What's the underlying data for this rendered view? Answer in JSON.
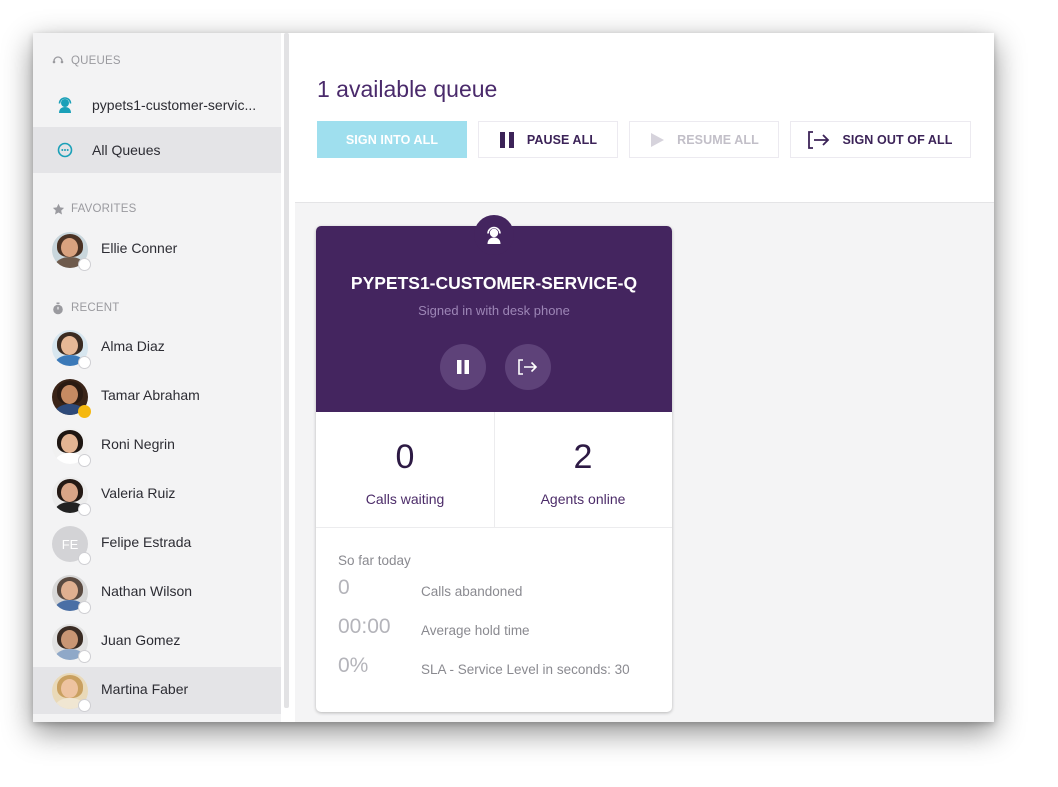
{
  "sidebar": {
    "queues_header": "QUEUES",
    "queue_items": [
      {
        "label": "pypets1-customer-servic...",
        "icon": "agent-headset-icon"
      },
      {
        "label": "All Queues",
        "icon": "chat-bubble-icon"
      }
    ],
    "favorites_header": "FAVORITES",
    "favorites": [
      {
        "name": "Ellie Conner"
      }
    ],
    "recent_header": "RECENT",
    "recent": [
      {
        "name": "Alma Diaz",
        "status": "offline"
      },
      {
        "name": "Tamar Abraham",
        "status": "away"
      },
      {
        "name": "Roni Negrin",
        "status": "offline"
      },
      {
        "name": "Valeria Ruiz",
        "status": "offline"
      },
      {
        "name": "Felipe Estrada",
        "initials": "FE",
        "status": "offline"
      },
      {
        "name": "Nathan Wilson",
        "status": "offline"
      },
      {
        "name": "Juan Gomez",
        "status": "offline"
      },
      {
        "name": "Martina Faber",
        "status": "offline"
      }
    ]
  },
  "main": {
    "title": "1 available queue",
    "toolbar": {
      "sign_into_all": "SIGN INTO ALL",
      "pause_all": "PAUSE ALL",
      "resume_all": "RESUME ALL",
      "sign_out_of_all": "SIGN OUT OF ALL"
    },
    "queue_card": {
      "name": "PYPETS1-CUSTOMER-SERVICE-Q",
      "status": "Signed in with desk phone",
      "calls_waiting": "0",
      "calls_waiting_label": "Calls waiting",
      "agents_online": "2",
      "agents_online_label": "Agents online",
      "today_title": "So far today",
      "calls_abandoned": "0",
      "calls_abandoned_label": "Calls abandoned",
      "avg_hold_time": "00:00",
      "avg_hold_time_label": "Average hold time",
      "sla": "0%",
      "sla_label": "SLA - Service Level in seconds: 30"
    }
  },
  "colors": {
    "accent_purple": "#44255f",
    "title_purple": "#4a2a6b",
    "primary_button": "#9fdfee",
    "away_status": "#f5b80f",
    "teal_icon": "#1aa0b8"
  }
}
